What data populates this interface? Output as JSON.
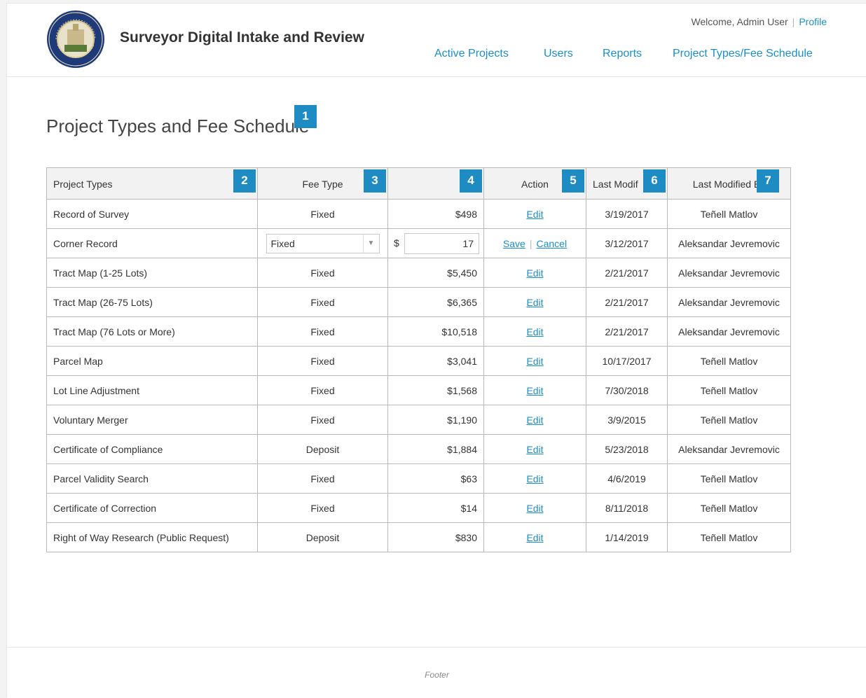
{
  "app": {
    "title": "Surveyor Digital Intake and Review",
    "logo_icon": "county-of-santa-barbara-seal"
  },
  "user_bar": {
    "welcome": "Welcome, Admin User",
    "separator": "|",
    "profile_link": "Profile"
  },
  "nav": {
    "items": [
      "Active Projects",
      "Users",
      "Reports",
      "Project Types/Fee Schedule"
    ]
  },
  "page": {
    "title": "Project Types and Fee Schedule"
  },
  "annotation_badges": [
    "1",
    "2",
    "3",
    "4",
    "5",
    "6",
    "7"
  ],
  "table": {
    "headers": [
      "Project Types",
      "Fee Type",
      "",
      "Action",
      "Last Modif",
      "Last Modified By"
    ],
    "rows": [
      {
        "type": "Record of Survey",
        "fee_type": "Fixed",
        "amount": "$498",
        "action": "Edit",
        "modified": "3/19/2017",
        "modified_by": "Teñell Matlov"
      },
      {
        "type": "Corner Record",
        "editing": true,
        "fee_type": "Fixed",
        "currency": "$",
        "amount": "17",
        "save": "Save",
        "cancel": "Cancel",
        "modified": "3/12/2017",
        "modified_by": "Aleksandar Jevremovic"
      },
      {
        "type": "Tract Map (1-25 Lots)",
        "fee_type": "Fixed",
        "amount": "$5,450",
        "action": "Edit",
        "modified": "2/21/2017",
        "modified_by": "Aleksandar Jevremovic"
      },
      {
        "type": "Tract Map (26-75 Lots)",
        "fee_type": "Fixed",
        "amount": "$6,365",
        "action": "Edit",
        "modified": "2/21/2017",
        "modified_by": "Aleksandar Jevremovic"
      },
      {
        "type": "Tract Map (76 Lots or More)",
        "fee_type": "Fixed",
        "amount": "$10,518",
        "action": "Edit",
        "modified": "2/21/2017",
        "modified_by": "Aleksandar Jevremovic"
      },
      {
        "type": "Parcel Map",
        "fee_type": "Fixed",
        "amount": "$3,041",
        "action": "Edit",
        "modified": "10/17/2017",
        "modified_by": "Teñell Matlov"
      },
      {
        "type": "Lot Line Adjustment",
        "fee_type": "Fixed",
        "amount": "$1,568",
        "action": "Edit",
        "modified": "7/30/2018",
        "modified_by": "Teñell Matlov"
      },
      {
        "type": "Voluntary Merger",
        "fee_type": "Fixed",
        "amount": "$1,190",
        "action": "Edit",
        "modified": "3/9/2015",
        "modified_by": "Teñell Matlov"
      },
      {
        "type": "Certificate of Compliance",
        "fee_type": "Deposit",
        "amount": "$1,884",
        "action": "Edit",
        "modified": "5/23/2018",
        "modified_by": "Aleksandar Jevremovic"
      },
      {
        "type": "Parcel Validity Search",
        "fee_type": "Fixed",
        "amount": "$63",
        "action": "Edit",
        "modified": "4/6/2019",
        "modified_by": "Teñell Matlov"
      },
      {
        "type": "Certificate of Correction",
        "fee_type": "Fixed",
        "amount": "$14",
        "action": "Edit",
        "modified": "8/11/2018",
        "modified_by": "Teñell Matlov"
      },
      {
        "type": "Right of Way Research (Public Request)",
        "fee_type": "Deposit",
        "amount": "$830",
        "action": "Edit",
        "modified": "1/14/2019",
        "modified_by": "Teñell Matlov"
      }
    ]
  },
  "footer": {
    "text": "Footer"
  },
  "colors": {
    "accent": "#1a8fc7",
    "badge": "#1e8bc3",
    "header_bg": "#f2f2f2",
    "border": "#b9b9b9"
  }
}
